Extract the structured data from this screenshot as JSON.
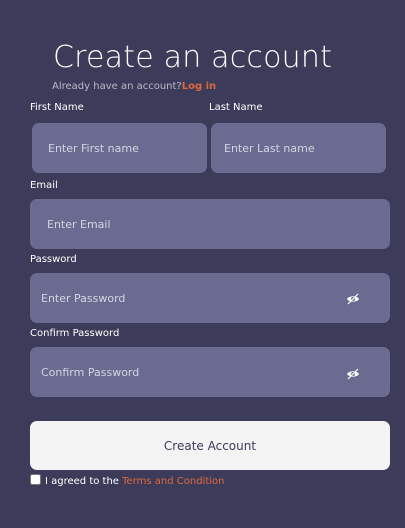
{
  "header": {
    "title": "Create an account",
    "subtitle": "Already have an account?",
    "login_link": "Log in"
  },
  "form": {
    "first_name": {
      "label": "First Name",
      "placeholder": "Enter First name",
      "value": ""
    },
    "last_name": {
      "label": "Last Name",
      "placeholder": "Enter Last name",
      "value": ""
    },
    "email": {
      "label": "Email",
      "placeholder": "Enter Email",
      "value": ""
    },
    "password": {
      "label": "Password",
      "placeholder": "Enter Password",
      "value": "",
      "icon": "eye-icon"
    },
    "confirm_password": {
      "label": "Confirm Password",
      "placeholder": "Confirm Password",
      "value": "",
      "icon": "eye-icon"
    },
    "submit_label": "Create Account",
    "agree": {
      "checked": false,
      "text": "I agreed to the ",
      "link": "Terms and Condition"
    }
  },
  "colors": {
    "background": "#3c3c5a",
    "field": "#6b6b91",
    "accent": "#e0683a",
    "button": "#f3f3f4"
  }
}
